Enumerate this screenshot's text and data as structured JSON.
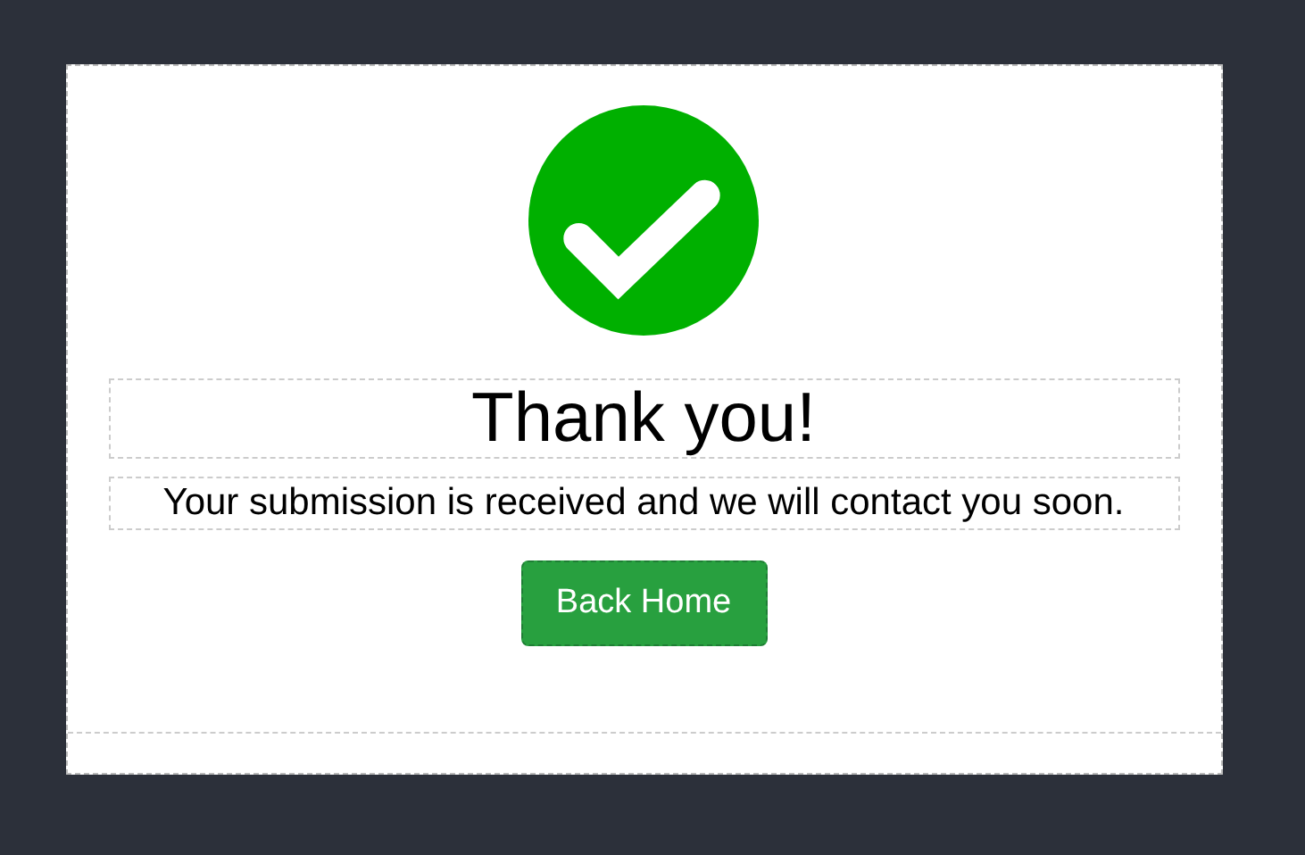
{
  "title": "Thank you!",
  "message": "Your submission is received and we will contact you soon.",
  "button": {
    "label": "Back Home"
  }
}
